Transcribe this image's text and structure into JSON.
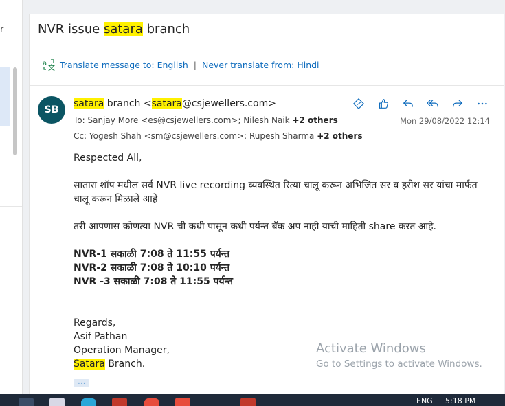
{
  "left_pane": {
    "fragment": "r"
  },
  "email": {
    "subject_parts": [
      "NVR issue ",
      "satara",
      " branch"
    ],
    "translate": {
      "link1": "Translate message to: English",
      "separator": "|",
      "link2": "Never translate from: Hindi"
    },
    "avatar_initials": "SB",
    "sender_parts": [
      "satara",
      " branch <",
      "satara",
      "@csjewellers.com>"
    ],
    "to": {
      "label": "To:",
      "recipients": "Sanjay More <es@csjewellers.com>;  Nilesh Naik",
      "more": "+2 others"
    },
    "cc": {
      "label": "Cc:",
      "recipients": "Yogesh Shah <sm@csjewellers.com>;  Rupesh Sharma",
      "more": "+2 others"
    },
    "date": "Mon 29/08/2022 12:14",
    "body": {
      "greeting": "Respected All,",
      "para1": "सातारा शॉप मधील सर्व NVR live recording व्यवस्थित रित्या चालू करून अभिजित सर व हरीश सर यांचा मार्फत चालू करून मिळाले आहे",
      "para2": "तरी आपणास कोणत्या NVR ची कधी पासून कधी पर्यन्त बॅक अप नाही याची माहिती share करत आहे.",
      "nvr_lines": [
        "NVR-1 सकाळी 7:08 ते 11:55 पर्यन्त",
        "NVR-2 सकाळी 7:08 ते 10:10 पर्यन्त",
        "NVR -3 सकाळी 7:08 ते 11:55 पर्यन्त"
      ],
      "regards": "Regards,",
      "name": "Asif Pathan",
      "title": "Operation Manager,",
      "branch_highlight": "Satara",
      "branch_rest": " Branch.",
      "ellipsis": "···"
    },
    "actions": [
      "link-icon",
      "like-icon",
      "reply-icon",
      "reply-all-icon",
      "forward-icon",
      "more-icon"
    ]
  },
  "watermark": {
    "line1": "Activate Windows",
    "line2": "Go to Settings to activate Windows."
  },
  "taskbar": {
    "lang": "ENG",
    "time": "5:18 PM"
  },
  "colors": {
    "accent": "#0f6cbd",
    "highlight": "#fff100",
    "avatar": "#0b5563",
    "taskbar": "#1f2a3a"
  }
}
